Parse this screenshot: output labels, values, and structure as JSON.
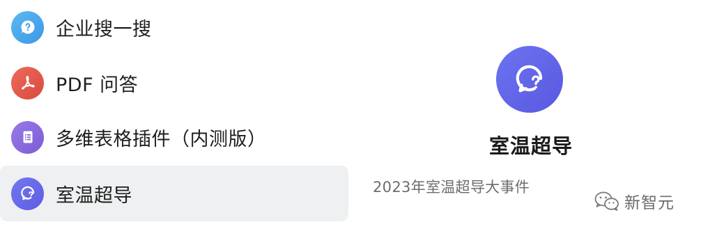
{
  "menu": {
    "items": [
      {
        "label": "企业搜一搜",
        "icon": "chat-question-icon",
        "color": "#4ba8ec",
        "selected": false
      },
      {
        "label": "PDF 问答",
        "icon": "pdf-icon",
        "color": "#e0564a",
        "selected": false
      },
      {
        "label": "多维表格插件（内测版）",
        "icon": "table-icon",
        "color": "#8a6ae0",
        "selected": false
      },
      {
        "label": "室温超导",
        "icon": "chat-question-icon",
        "color": "#6466e8",
        "selected": true
      }
    ]
  },
  "detail": {
    "icon": "chat-question-icon",
    "title": "室温超导",
    "description": "2023年室温超导大事件"
  },
  "watermark": {
    "text": "新智元",
    "icon": "wechat-icon"
  },
  "colors": {
    "selected_bg": "#eff0f1",
    "accent": "#5f5fe6",
    "text": "#1f1f1f",
    "muted_text": "#6d6d6d"
  }
}
